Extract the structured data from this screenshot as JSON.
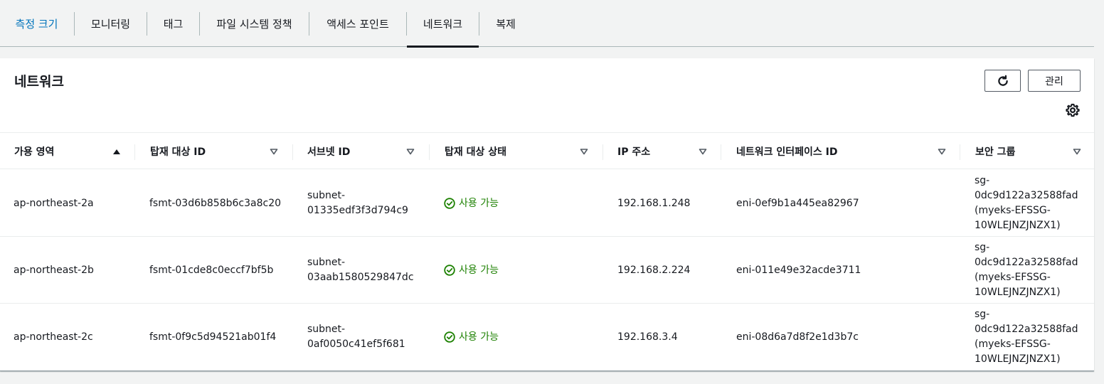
{
  "tabs": [
    {
      "label": "측정 크기"
    },
    {
      "label": "모니터링"
    },
    {
      "label": "태그"
    },
    {
      "label": "파일 시스템 정책"
    },
    {
      "label": "액세스 포인트"
    },
    {
      "label": "네트워크"
    },
    {
      "label": "복제"
    }
  ],
  "panel": {
    "title": "네트워크",
    "manage_label": "관리"
  },
  "table": {
    "columns": [
      {
        "label": "가용 영역",
        "sort": "ascending"
      },
      {
        "label": "탑재 대상 ID",
        "sort": "none"
      },
      {
        "label": "서브넷 ID",
        "sort": "none"
      },
      {
        "label": "탑재 대상 상태",
        "sort": "none"
      },
      {
        "label": "IP 주소",
        "sort": "none"
      },
      {
        "label": "네트워크 인터페이스 ID",
        "sort": "none"
      },
      {
        "label": "보안 그룹",
        "sort": "none"
      }
    ],
    "rows": [
      {
        "az": "ap-northeast-2a",
        "mount_target_id": "fsmt-03d6b858b6c3a8c20",
        "subnet_line1": "subnet-",
        "subnet_line2": "01335edf3f3d794c9",
        "status": "사용 가능",
        "ip": "192.168.1.248",
        "eni": "eni-0ef9b1a445ea82967",
        "sg_line1": "sg-",
        "sg_line2": "0dc9d122a32588fad",
        "sg_line3": "(myeks-EFSSG-",
        "sg_line4": "10WLEJNZJNZX1)"
      },
      {
        "az": "ap-northeast-2b",
        "mount_target_id": "fsmt-01cde8c0eccf7bf5b",
        "subnet_line1": "subnet-",
        "subnet_line2": "03aab1580529847dc",
        "status": "사용 가능",
        "ip": "192.168.2.224",
        "eni": "eni-011e49e32acde3711",
        "sg_line1": "sg-",
        "sg_line2": "0dc9d122a32588fad",
        "sg_line3": "(myeks-EFSSG-",
        "sg_line4": "10WLEJNZJNZX1)"
      },
      {
        "az": "ap-northeast-2c",
        "mount_target_id": "fsmt-0f9c5d94521ab01f4",
        "subnet_line1": "subnet-",
        "subnet_line2": "0af0050c41ef5f681",
        "status": "사용 가능",
        "ip": "192.168.3.4",
        "eni": "eni-08d6a7d8f2e1d3b7c",
        "sg_line1": "sg-",
        "sg_line2": "0dc9d122a32588fad",
        "sg_line3": "(myeks-EFSSG-",
        "sg_line4": "10WLEJNZJNZX1)"
      }
    ]
  },
  "icons": {
    "refresh": "refresh-icon",
    "settings": "gear-icon",
    "sort_asc": "caret-up-icon",
    "sort_none": "caret-down-outline-icon",
    "status_ok": "check-circle-icon"
  },
  "colors": {
    "accent_blue": "#0073bb",
    "success_green": "#1d8102"
  }
}
